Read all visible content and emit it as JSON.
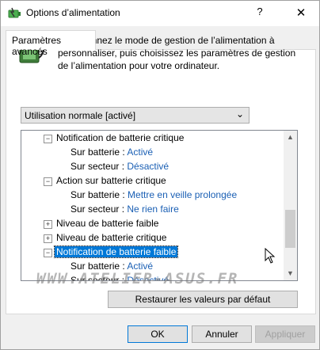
{
  "window": {
    "title": "Options d’alimentation",
    "help": "?",
    "close": "✕"
  },
  "tab": {
    "label": "Paramètres avancés"
  },
  "description": "Sélectionnez le mode de gestion de l’alimentation à personnaliser, puis choisissez les paramètres de gestion de l’alimentation pour votre ordinateur.",
  "plan": {
    "selected": "Utilisation normale [activé]"
  },
  "tree": {
    "n1": {
      "label": "Notification de batterie critique",
      "on_battery_label": "Sur batterie :",
      "on_battery_value": "Activé",
      "plugged_label": "Sur secteur :",
      "plugged_value": "Désactivé"
    },
    "n2": {
      "label": "Action sur batterie critique",
      "on_battery_label": "Sur batterie :",
      "on_battery_value": "Mettre en veille prolongée",
      "plugged_label": "Sur secteur :",
      "plugged_value": "Ne rien faire"
    },
    "n3": {
      "label": "Niveau de batterie faible"
    },
    "n4": {
      "label": "Niveau de batterie critique"
    },
    "n5": {
      "label": "Notification de batterie faible",
      "on_battery_label": "Sur batterie :",
      "on_battery_value": "Activé",
      "plugged_label": "Sur secteur :",
      "plugged_value": "Désactivé"
    }
  },
  "watermark": "WWW.ATELIER-ASUS.FR",
  "buttons": {
    "restore": "Restaurer les valeurs par défaut",
    "ok": "OK",
    "cancel": "Annuler",
    "apply": "Appliquer"
  },
  "colors": {
    "accent": "#0078d7",
    "value_text": "#1a5fb4"
  },
  "icons": {
    "app": "power-options-icon",
    "battery": "battery-plug-icon"
  }
}
